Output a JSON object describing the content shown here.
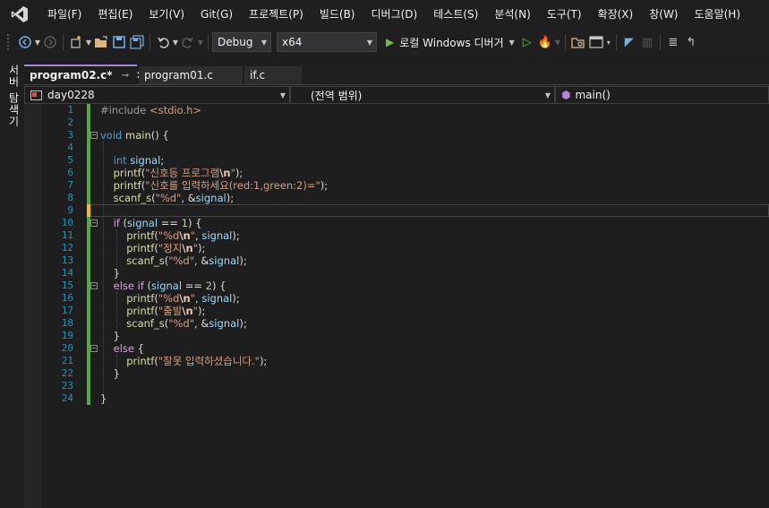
{
  "menu": [
    "파일(F)",
    "편집(E)",
    "보기(V)",
    "Git(G)",
    "프로젝트(P)",
    "빌드(B)",
    "디버그(D)",
    "테스트(S)",
    "분석(N)",
    "도구(T)",
    "확장(X)",
    "창(W)",
    "도움말(H)"
  ],
  "toolbar": {
    "config": "Debug",
    "platform": "x64",
    "run_label": "로컬 Windows 디버거"
  },
  "siderail": {
    "label": "서버 탐색기"
  },
  "tabs": [
    {
      "label": "program02.c*",
      "active": true
    },
    {
      "label": "program01.c",
      "active": false
    },
    {
      "label": "if.c",
      "active": false
    }
  ],
  "nav": {
    "project": "day0228",
    "scope": "(전역 범위)",
    "member": "main()"
  },
  "icons": {
    "logo": "visual-studio-logo",
    "back": "navigate-back-icon",
    "forward": "navigate-forward-icon",
    "new": "new-project-icon",
    "open": "open-folder-icon",
    "save": "save-icon",
    "save_all": "save-all-icon",
    "undo": "undo-icon",
    "redo": "redo-icon",
    "play": "start-debugging-icon",
    "pin": "pin-icon",
    "close": "close-icon"
  },
  "colors": {
    "accent": "#a285e0",
    "change_saved": "#57a64a",
    "change_unsaved": "#efb93f",
    "line_number": "#2b91af"
  },
  "code_lines": [
    "#include <stdio.h>",
    "",
    "void main() {",
    "",
    "    int signal;",
    "    printf(\"신호등 프로그램\\n\");",
    "    printf(\"신호를 입력하세요(red:1,green:2)=\");",
    "    scanf_s(\"%d\", &signal);",
    "",
    "    if (signal == 1) {",
    "        printf(\"%d\\n\", signal);",
    "        printf(\"정지\\n\");",
    "        scanf_s(\"%d\", &signal);",
    "    }",
    "    else if (signal == 2) {",
    "        printf(\"%d\\n\", signal);",
    "        printf(\"출발\\n\");",
    "        scanf_s(\"%d\", &signal);",
    "    }",
    "    else {",
    "        printf(\"잘못 입력하셨습니다.\");",
    "    }",
    "",
    "}"
  ]
}
